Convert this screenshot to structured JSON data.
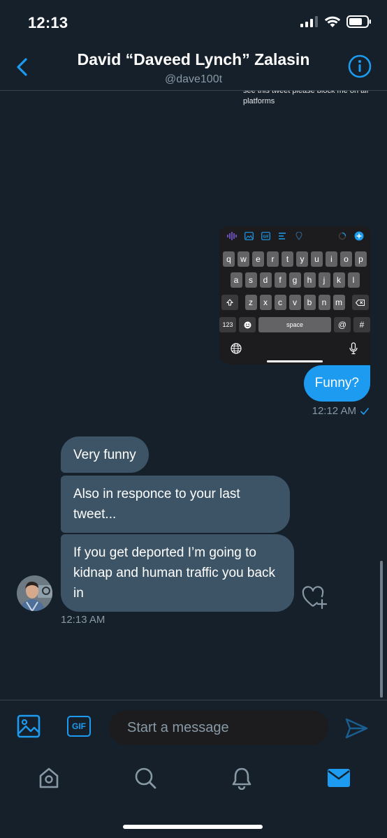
{
  "status_bar": {
    "time": "12:13"
  },
  "header": {
    "title": "David “Daveed Lynch” Zalasin",
    "handle": "@dave100t"
  },
  "media": {
    "caption_text": "see this tweet please block me on all platforms",
    "keyboard": {
      "row1": [
        "q",
        "w",
        "e",
        "r",
        "t",
        "y",
        "u",
        "i",
        "o",
        "p"
      ],
      "row2": [
        "a",
        "s",
        "d",
        "f",
        "g",
        "h",
        "j",
        "k",
        "l"
      ],
      "row3": [
        "z",
        "x",
        "c",
        "v",
        "b",
        "n",
        "m"
      ],
      "numbers_key": "123",
      "space_key": "space",
      "at_key": "@",
      "hash_key": "#"
    }
  },
  "messages": {
    "outgoing": {
      "text": "Funny?",
      "time": "12:12 AM"
    },
    "incoming": [
      {
        "text": "Very funny"
      },
      {
        "text": "Also in responce to your last tweet..."
      },
      {
        "text": "If you get deported I’m going to kidnap and human traffic you back in"
      }
    ],
    "incoming_time": "12:13 AM"
  },
  "composer": {
    "gif_label": "GIF",
    "placeholder": "Start a message"
  },
  "tabs": [
    "home-icon",
    "search-icon",
    "notifications-icon",
    "messages-icon"
  ],
  "colors": {
    "background": "#15202b",
    "accent": "#1d9bf0",
    "incoming_bubble": "#3d5466",
    "muted_text": "#8899a6"
  }
}
